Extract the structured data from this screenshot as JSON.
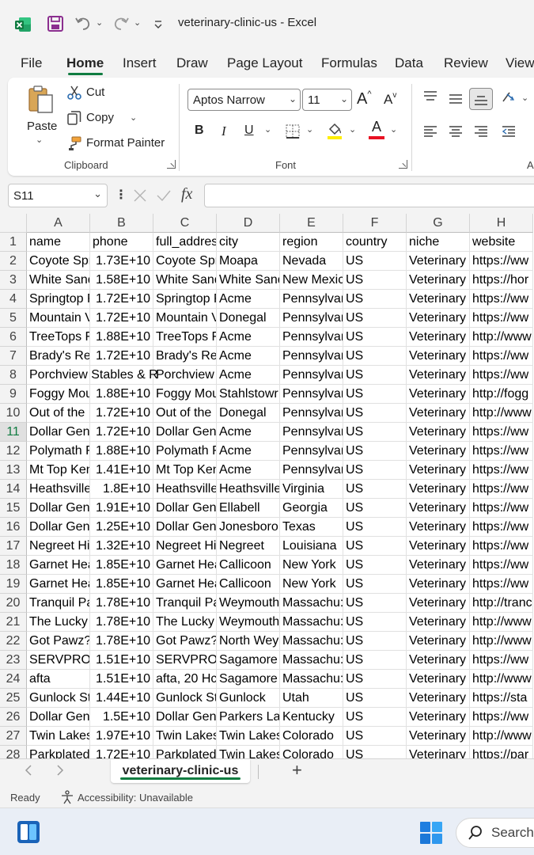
{
  "window": {
    "title": "veterinary-clinic-us  -  Excel"
  },
  "menu": {
    "tabs": [
      {
        "label": "File"
      },
      {
        "label": "Home"
      },
      {
        "label": "Insert"
      },
      {
        "label": "Draw"
      },
      {
        "label": "Page Layout"
      },
      {
        "label": "Formulas"
      },
      {
        "label": "Data"
      },
      {
        "label": "Review"
      },
      {
        "label": "View"
      }
    ]
  },
  "ribbon": {
    "clipboard": {
      "paste": "Paste",
      "cut": "Cut",
      "copy": "Copy",
      "format_painter": "Format Painter",
      "group": "Clipboard"
    },
    "font": {
      "family": "Aptos Narrow",
      "size": "11",
      "group": "Font",
      "bold": "B",
      "italic": "I",
      "underline": "U",
      "grow": "A",
      "shrink": "A",
      "font_color": "A"
    },
    "alignment": {
      "group": "A"
    }
  },
  "formula_bar": {
    "name_box": "S11",
    "fx": "fx",
    "formula": ""
  },
  "grid": {
    "columns": [
      "A",
      "B",
      "C",
      "D",
      "E",
      "F",
      "G",
      "H"
    ],
    "selected_row": "11",
    "rows": [
      {
        "n": "1",
        "cells": [
          "name",
          "phone",
          "full_address",
          "city",
          "region",
          "country",
          "niche",
          "website"
        ]
      },
      {
        "n": "2",
        "cells": [
          "Coyote Spr",
          "1.73E+10",
          "Coyote Spr",
          "Moapa",
          "Nevada",
          "US",
          "Veterinary",
          "https://ww"
        ]
      },
      {
        "n": "3",
        "cells": [
          "White Sand",
          "1.58E+10",
          "White Sand",
          "White Sand",
          "New Mexic",
          "US",
          "Veterinary",
          "https://hor"
        ]
      },
      {
        "n": "4",
        "cells": [
          "Springtop F",
          "1.72E+10",
          "Springtop F",
          "Acme",
          "Pennsylvar",
          "US",
          "Veterinary",
          "https://ww"
        ]
      },
      {
        "n": "5",
        "cells": [
          "Mountain V",
          "1.72E+10",
          "Mountain V",
          "Donegal",
          "Pennsylvar",
          "US",
          "Veterinary",
          "https://ww"
        ]
      },
      {
        "n": "6",
        "cells": [
          "TreeTops F",
          "1.88E+10",
          "TreeTops F",
          "Acme",
          "Pennsylvar",
          "US",
          "Veterinary",
          "http://www"
        ]
      },
      {
        "n": "7",
        "cells": [
          "Brady's Res",
          "1.72E+10",
          "Brady's Res",
          "Acme",
          "Pennsylvar",
          "US",
          "Veterinary",
          "https://ww"
        ]
      },
      {
        "n": "8",
        "cells": [
          "Porchview Stables & R",
          "",
          "Porchview",
          "Acme",
          "Pennsylvar",
          "US",
          "Veterinary",
          "https://ww"
        ]
      },
      {
        "n": "9",
        "cells": [
          "Foggy Mou",
          "1.88E+10",
          "Foggy Mou",
          "Stahlstowr",
          "Pennsylvar",
          "US",
          "Veterinary",
          "http://fogg"
        ]
      },
      {
        "n": "10",
        "cells": [
          "Out of the F",
          "1.72E+10",
          "Out of the F",
          "Donegal",
          "Pennsylvar",
          "US",
          "Veterinary",
          "http://www"
        ]
      },
      {
        "n": "11",
        "cells": [
          "Dollar Gen",
          "1.72E+10",
          "Dollar Gen",
          "Acme",
          "Pennsylvar",
          "US",
          "Veterinary",
          "https://ww"
        ]
      },
      {
        "n": "12",
        "cells": [
          "Polymath F",
          "1.88E+10",
          "Polymath F",
          "Acme",
          "Pennsylvar",
          "US",
          "Veterinary",
          "https://ww"
        ]
      },
      {
        "n": "13",
        "cells": [
          "Mt Top Ken",
          "1.41E+10",
          "Mt Top Ken",
          "Acme",
          "Pennsylvar",
          "US",
          "Veterinary",
          "https://ww"
        ]
      },
      {
        "n": "14",
        "cells": [
          "Heathsville",
          "1.8E+10",
          "Heathsville",
          "Heathsville",
          "Virginia",
          "US",
          "Veterinary",
          "https://ww"
        ]
      },
      {
        "n": "15",
        "cells": [
          "Dollar Gen",
          "1.91E+10",
          "Dollar Gen",
          "Ellabell",
          "Georgia",
          "US",
          "Veterinary",
          "https://ww"
        ]
      },
      {
        "n": "16",
        "cells": [
          "Dollar Gen",
          "1.25E+10",
          "Dollar Gen",
          "Jonesboro",
          "Texas",
          "US",
          "Veterinary",
          "https://ww"
        ]
      },
      {
        "n": "17",
        "cells": [
          "Negreet Hi",
          "1.32E+10",
          "Negreet Hi",
          "Negreet",
          "Louisiana",
          "US",
          "Veterinary",
          "https://ww"
        ]
      },
      {
        "n": "18",
        "cells": [
          "Garnet Hea",
          "1.85E+10",
          "Garnet Hea",
          "Callicoon",
          "New York",
          "US",
          "Veterinary",
          "https://ww"
        ]
      },
      {
        "n": "19",
        "cells": [
          "Garnet Hea",
          "1.85E+10",
          "Garnet Hea",
          "Callicoon",
          "New York",
          "US",
          "Veterinary",
          "https://ww"
        ]
      },
      {
        "n": "20",
        "cells": [
          "Tranquil Pa",
          "1.78E+10",
          "Tranquil Pa",
          "Weymouth",
          "Massachu:",
          "US",
          "Veterinary",
          "http://tranc"
        ]
      },
      {
        "n": "21",
        "cells": [
          "The Lucky I",
          "1.78E+10",
          "The Lucky I",
          "Weymouth",
          "Massachu:",
          "US",
          "Veterinary",
          "http://www"
        ]
      },
      {
        "n": "22",
        "cells": [
          "Got Pawz?",
          "1.78E+10",
          "Got Pawz?",
          "North Wey",
          "Massachu:",
          "US",
          "Veterinary",
          "http://www"
        ]
      },
      {
        "n": "23",
        "cells": [
          "SERVPRO c",
          "1.51E+10",
          "SERVPRO c",
          "Sagamore",
          "Massachu:",
          "US",
          "Veterinary",
          "https://ww"
        ]
      },
      {
        "n": "24",
        "cells": [
          "afta",
          "1.51E+10",
          "afta, 20 Hc",
          "Sagamore",
          "Massachu:",
          "US",
          "Veterinary",
          "http://www"
        ]
      },
      {
        "n": "25",
        "cells": [
          "Gunlock St",
          "1.44E+10",
          "Gunlock St",
          "Gunlock",
          "Utah",
          "US",
          "Veterinary",
          "https://sta"
        ]
      },
      {
        "n": "26",
        "cells": [
          "Dollar Gen",
          "1.5E+10",
          "Dollar Gen",
          "Parkers La",
          "Kentucky",
          "US",
          "Veterinary",
          "https://ww"
        ]
      },
      {
        "n": "27",
        "cells": [
          "Twin Lakes",
          "1.97E+10",
          "Twin Lakes",
          "Twin Lakes",
          "Colorado",
          "US",
          "Veterinary",
          "http://www"
        ]
      },
      {
        "n": "28",
        "cells": [
          "Parkplated",
          "1.72E+10",
          "Parkplated",
          "Twin Lakes",
          "Colorado",
          "US",
          "Veterinary",
          "https://par"
        ]
      }
    ]
  },
  "sheets": {
    "active": "veterinary-clinic-us",
    "add": "+"
  },
  "status": {
    "ready": "Ready",
    "accessibility": "Accessibility: Unavailable"
  },
  "taskbar": {
    "search": "Search"
  },
  "colors": {
    "accent": "#107c41",
    "font_color_bar": "#e81123",
    "highlight_bar": "#ffee00"
  }
}
